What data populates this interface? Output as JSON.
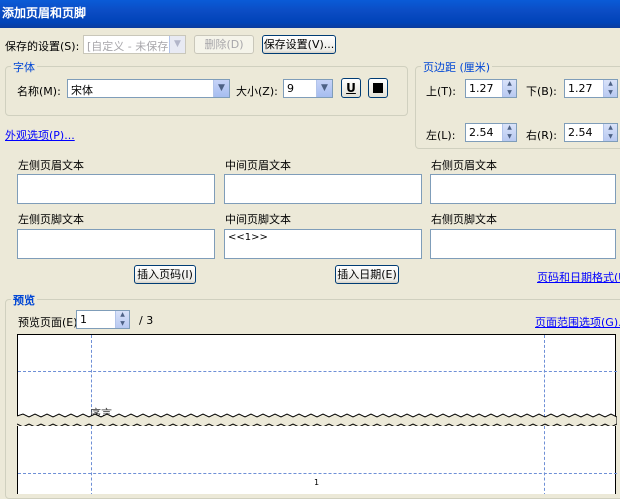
{
  "window": {
    "title": "添加页眉和页脚"
  },
  "saved_settings": {
    "label": "保存的设置(S):",
    "value": "[自定义 - 未保存]",
    "delete_label": "删除(D)",
    "save_label": "保存设置(V)..."
  },
  "font": {
    "legend": "字体",
    "name_label": "名称(M):",
    "name_value": "宋体",
    "size_label": "大小(Z):",
    "size_value": "9",
    "underline_label": "U"
  },
  "margins": {
    "legend": "页边距 (厘米)",
    "top_label": "上(T):",
    "top_value": "1.27",
    "bottom_label": "下(B):",
    "bottom_value": "1.27",
    "left_label": "左(L):",
    "left_value": "2.54",
    "right_label": "右(R):",
    "right_value": "2.54"
  },
  "appearance_link": "外观选项(P)...",
  "header": {
    "left_label": "左侧页眉文本",
    "center_label": "中间页眉文本",
    "right_label": "右侧页眉文本",
    "left_value": "",
    "center_value": "",
    "right_value": ""
  },
  "footer": {
    "left_label": "左侧页脚文本",
    "center_label": "中间页脚文本",
    "right_label": "右侧页脚文本",
    "left_value": "",
    "center_value": "<<1>>",
    "right_value": ""
  },
  "insert_page_number": "插入页码(I)",
  "insert_date": "插入日期(E)",
  "page_date_format_link": "页码和日期格式(U)...",
  "preview": {
    "legend": "预览",
    "page_label": "预览页面(E)",
    "page_value": "1",
    "total": "/ 3",
    "range_link": "页面范围选项(G)...",
    "body_text": "序言",
    "page_number": "1"
  },
  "colors": {
    "title_bar": "#0a5bd7",
    "legend": "#0046d5",
    "link": "#0000ff",
    "dialog": "#ece9d8"
  }
}
